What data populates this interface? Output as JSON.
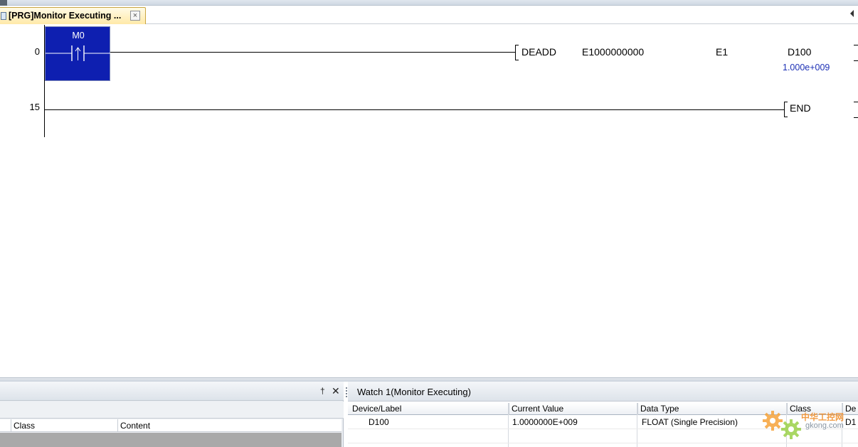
{
  "tab": {
    "label": "[PRG]Monitor Executing ...",
    "close_symbol": "×"
  },
  "ladder": {
    "rung0": {
      "step": "0",
      "contact_device": "M0",
      "instruction": "DEADD",
      "operand1": "E1000000000",
      "operand2": "E1",
      "operand3": "D100",
      "monitor_value": "1.000e+009"
    },
    "rung1": {
      "step": "15",
      "instruction": "END"
    }
  },
  "left_panel": {
    "pin_symbol": "ᴾ",
    "close_symbol": "✕",
    "columns": [
      "Class",
      "Content"
    ]
  },
  "watch": {
    "title": "Watch 1(Monitor Executing)",
    "columns": [
      "Device/Label",
      "Current Value",
      "Data Type",
      "Class",
      "De"
    ],
    "rows": [
      [
        "D100",
        "1.0000000E+009",
        "FLOAT (Single Precision)",
        "",
        "D1"
      ]
    ]
  },
  "watermark": {
    "text1": "中华工控网",
    "text2": "gkong.com"
  },
  "colors": {
    "contact_fill": "#0e1fb0",
    "monitor_value": "#1b2fb5",
    "tab_fill": "#ffe9a8"
  }
}
